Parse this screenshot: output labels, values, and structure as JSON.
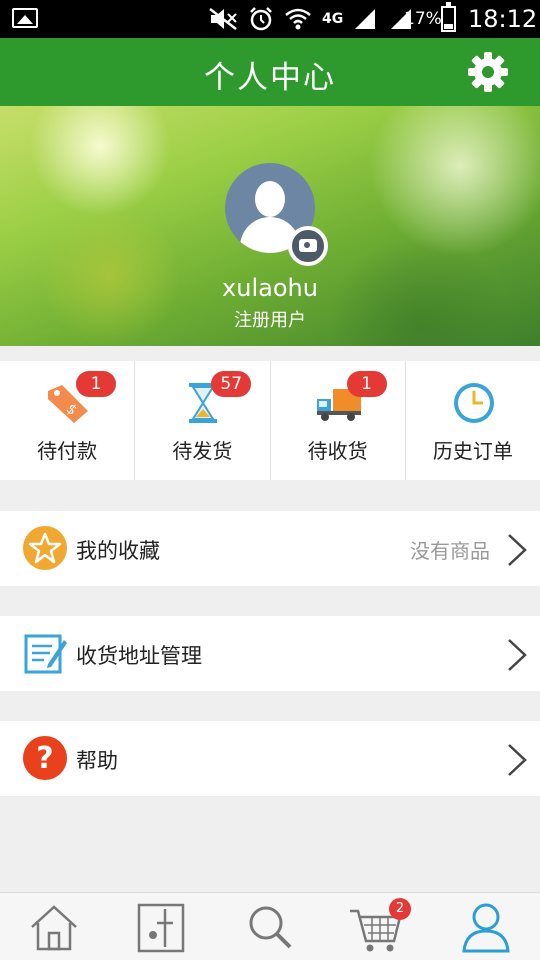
{
  "status_bar": {
    "network": "4G",
    "battery": "17%",
    "time": "18:12"
  },
  "header": {
    "title": "个人中心",
    "settings_icon": "gear-icon"
  },
  "profile": {
    "username": "xulaohu",
    "user_type": "注册用户"
  },
  "orders": [
    {
      "label": "待付款",
      "badge": "1",
      "icon": "price-tag-icon"
    },
    {
      "label": "待发货",
      "badge": "57",
      "icon": "hourglass-icon"
    },
    {
      "label": "待收货",
      "badge": "1",
      "icon": "delivery-truck-icon"
    },
    {
      "label": "历史订单",
      "badge": "",
      "icon": "clock-icon"
    }
  ],
  "rows": {
    "favorites": {
      "label": "我的收藏",
      "value": "没有商品",
      "icon": "star-icon"
    },
    "address": {
      "label": "收货地址管理",
      "icon": "notepad-icon"
    },
    "help": {
      "label": "帮助",
      "icon": "question-icon"
    }
  },
  "tabbar": {
    "cart_badge": "2",
    "tabs": [
      "home-icon",
      "category-icon",
      "search-icon",
      "cart-icon",
      "user-icon"
    ]
  },
  "colors": {
    "brand_green": "#2e9a2e",
    "badge_red": "#e53935",
    "active_tab": "#2a9fd6"
  }
}
